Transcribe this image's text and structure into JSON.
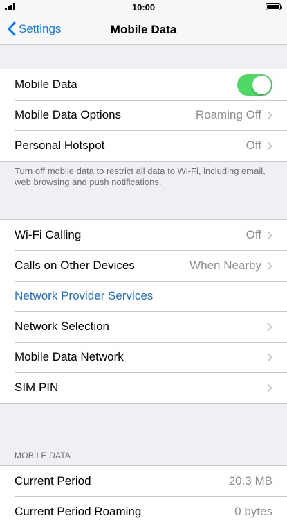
{
  "status_bar": {
    "time": "10:00"
  },
  "nav": {
    "back_label": "Settings",
    "title": "Mobile Data"
  },
  "group1": {
    "mobile_data": {
      "label": "Mobile Data",
      "toggle_on": true
    },
    "mobile_data_options": {
      "label": "Mobile Data Options",
      "value": "Roaming Off"
    },
    "personal_hotspot": {
      "label": "Personal Hotspot",
      "value": "Off"
    }
  },
  "group1_footer": "Turn off mobile data to restrict all data to Wi-Fi, including email, web browsing and push notifications.",
  "group2": {
    "wifi_calling": {
      "label": "Wi-Fi Calling",
      "value": "Off"
    },
    "calls_other_devices": {
      "label": "Calls on Other Devices",
      "value": "When Nearby"
    },
    "network_provider_services": {
      "label": "Network Provider Services"
    },
    "network_selection": {
      "label": "Network Selection"
    },
    "mobile_data_network": {
      "label": "Mobile Data Network"
    },
    "sim_pin": {
      "label": "SIM PIN"
    }
  },
  "mobile_data_section": {
    "header": "MOBILE DATA",
    "current_period": {
      "label": "Current Period",
      "value": "20.3 MB"
    },
    "current_period_roaming": {
      "label": "Current Period Roaming",
      "value": "0 bytes"
    }
  },
  "colors": {
    "accent": "#007aff",
    "toggle_on": "#4cd964",
    "link": "#1c6fcf",
    "secondary_text": "#8e8e93"
  }
}
